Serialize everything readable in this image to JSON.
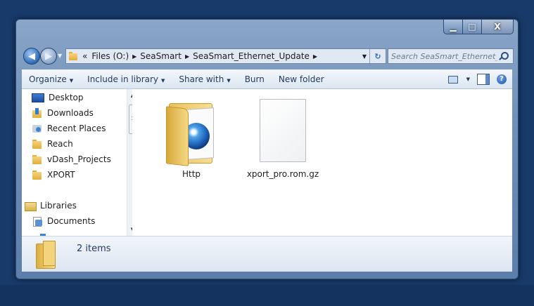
{
  "window": {
    "caption_buttons": {
      "minimize": "▁",
      "maximize": "□",
      "close": "X"
    }
  },
  "address": {
    "overflow": "«",
    "crumbs": [
      "Files (O:)",
      "SeaSmart",
      "SeaSmart_Ethernet_Update"
    ],
    "separator": "▶",
    "search_placeholder": "Search SeaSmart_Ethernet_Up..."
  },
  "toolbar": {
    "organize": "Organize",
    "include_in_library": "Include in library",
    "share_with": "Share with",
    "burn": "Burn",
    "new_folder": "New folder",
    "caret": "▼",
    "help": "?"
  },
  "nav": {
    "items": [
      {
        "label": "Desktop",
        "icon": "desktop-icon"
      },
      {
        "label": "Downloads",
        "icon": "downloads-icon"
      },
      {
        "label": "Recent Places",
        "icon": "recent-places-icon"
      },
      {
        "label": "Reach",
        "icon": "folder-icon"
      },
      {
        "label": "vDash_Projects",
        "icon": "folder-icon"
      },
      {
        "label": "XPORT",
        "icon": "folder-icon"
      },
      {
        "label": "Libraries",
        "icon": "libraries-icon"
      },
      {
        "label": "Documents",
        "icon": "documents-icon"
      }
    ]
  },
  "files": [
    {
      "name": "Http",
      "icon": "folder-with-globe-icon"
    },
    {
      "name": "xport_pro.rom.gz",
      "icon": "blank-document-icon"
    }
  ],
  "details": {
    "item_count": "2 items"
  }
}
